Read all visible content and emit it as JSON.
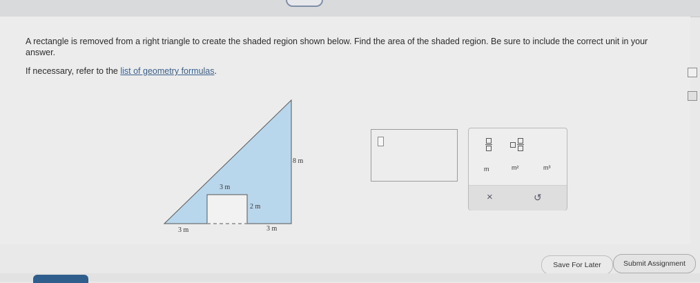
{
  "question": {
    "text": "A rectangle is removed from a right triangle to create the shaded region shown below. Find the area of the shaded region. Be sure to include the correct unit in your answer.",
    "refer_prefix": "If necessary, refer to the ",
    "refer_link": "list of geometry formulas",
    "refer_suffix": "."
  },
  "figure": {
    "label_height": "8 m",
    "label_rect_width": "3 m",
    "label_rect_height": "2 m",
    "label_base_left": "3 m",
    "label_base_right": "3 m",
    "shade_color": "#b9d7ec"
  },
  "palette": {
    "fraction_icon": "fraction-icon",
    "mixed_fraction_icon": "mixed-number-icon",
    "unit_m": "m",
    "unit_m2": "m²",
    "unit_m3": "m³",
    "clear_symbol": "×",
    "undo_symbol": "↺"
  },
  "buttons": {
    "save_label": "Save For Later",
    "submit_label": "Submit Assignment"
  }
}
